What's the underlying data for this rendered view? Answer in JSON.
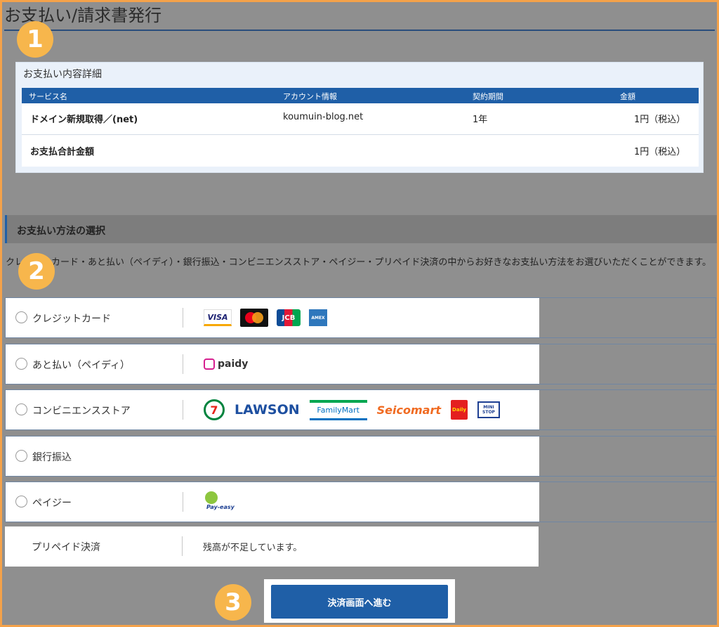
{
  "page": {
    "title": "お支払い/請求書発行"
  },
  "badges": [
    "1",
    "2",
    "3"
  ],
  "details": {
    "title": "お支払い内容詳細",
    "headers": [
      "サービス名",
      "アカウント情報",
      "契約期間",
      "金額"
    ],
    "row": {
      "service": "ドメイン新規取得／(net)",
      "account": "koumuin-blog.net",
      "period": "1年",
      "amount": "1円（税込）"
    },
    "total": {
      "label": "お支払合計金額",
      "amount": "1円（税込）"
    }
  },
  "payment": {
    "section_title": "お支払い方法の選択",
    "intro": "クレジットカード・あと払い（ペイディ）・銀行振込・コンビニエンスストア・ペイジー・プリペイド決済の中からお好きなお支払い方法をお選びいただくことができます。",
    "options": [
      {
        "label": "クレジットカード",
        "logos": [
          "VISA",
          "mastercard",
          "JCB",
          "AMEX"
        ]
      },
      {
        "label": "あと払い（ペイディ）",
        "logos": [
          "paidy"
        ]
      },
      {
        "label": "コンビニエンスストア",
        "logos": [
          "7",
          "LAWSON",
          "FamilyMart",
          "Seicomart",
          "Daily",
          "MINI STOP"
        ]
      },
      {
        "label": "銀行振込"
      },
      {
        "label": "ペイジー",
        "logos": [
          "Pay-easy"
        ]
      },
      {
        "label": "プリペイド決済",
        "note": "残高が不足しています。"
      }
    ]
  },
  "submit_label": "決済画面へ進む",
  "colors": {
    "accent": "#1f5fa7",
    "badge": "#f7b64c",
    "frame": "#f4a24a"
  }
}
